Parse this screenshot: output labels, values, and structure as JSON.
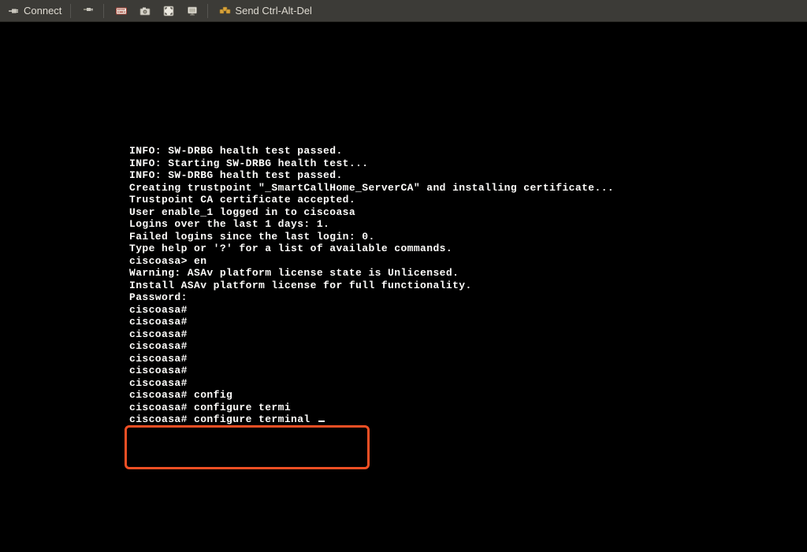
{
  "toolbar": {
    "connect_label": "Connect",
    "send_cad_label": "Send Ctrl-Alt-Del"
  },
  "console_lines": [
    "INFO: SW-DRBG health test passed.",
    "",
    "INFO: Starting SW-DRBG health test...",
    "INFO: SW-DRBG health test passed.",
    "Creating trustpoint \"_SmartCallHome_ServerCA\" and installing certificate...",
    "",
    "Trustpoint CA certificate accepted.",
    "User enable_1 logged in to ciscoasa",
    "Logins over the last 1 days: 1.",
    "Failed logins since the last login: 0.",
    "Type help or '?' for a list of available commands.",
    "ciscoasa> en",
    "Warning: ASAv platform license state is Unlicensed.",
    "Install ASAv platform license for full functionality.",
    "",
    "Password:",
    "ciscoasa#",
    "ciscoasa#",
    "ciscoasa#",
    "ciscoasa#",
    "ciscoasa#",
    "ciscoasa#",
    "ciscoasa#",
    "ciscoasa# config",
    "ciscoasa# configure termi",
    "ciscoasa# configure terminal "
  ]
}
